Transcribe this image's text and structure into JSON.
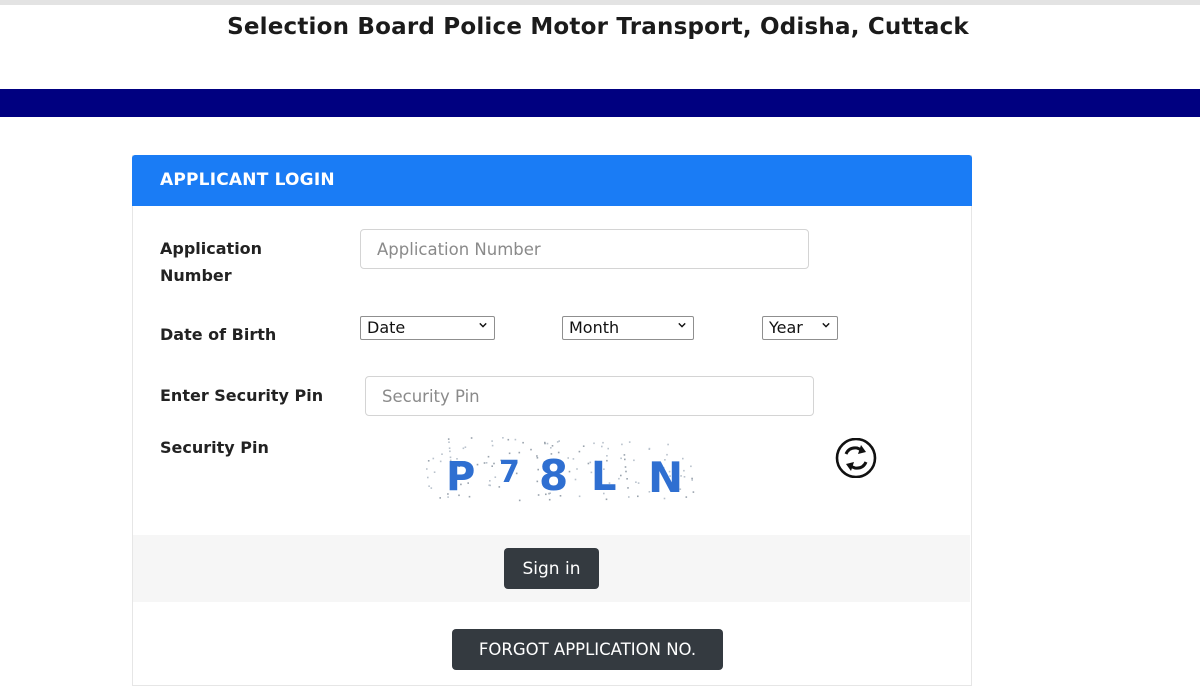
{
  "header": {
    "title": "Selection Board Police Motor Transport, Odisha, Cuttack"
  },
  "colors": {
    "navbar": "#000080",
    "card_header": "#1a7cf5",
    "button_dark": "#343a40",
    "captcha_text": "#2f6fd1"
  },
  "login_card": {
    "heading": "APPLICANT LOGIN",
    "application_number": {
      "label_line1": "Application",
      "label_line2": "Number",
      "value": "",
      "placeholder": "Application Number"
    },
    "date_of_birth": {
      "label": "Date of Birth",
      "date_select": "Date",
      "month_select": "Month",
      "year_select": "Year"
    },
    "security_pin_input": {
      "label": "Enter Security Pin",
      "value": "",
      "placeholder": "Security Pin"
    },
    "captcha": {
      "label": "Security Pin",
      "characters": [
        "P",
        "7",
        "8",
        "L",
        "N"
      ],
      "refresh_icon": "refresh-icon"
    },
    "sign_in_label": "Sign in",
    "forgot_label": "FORGOT APPLICATION NO."
  }
}
